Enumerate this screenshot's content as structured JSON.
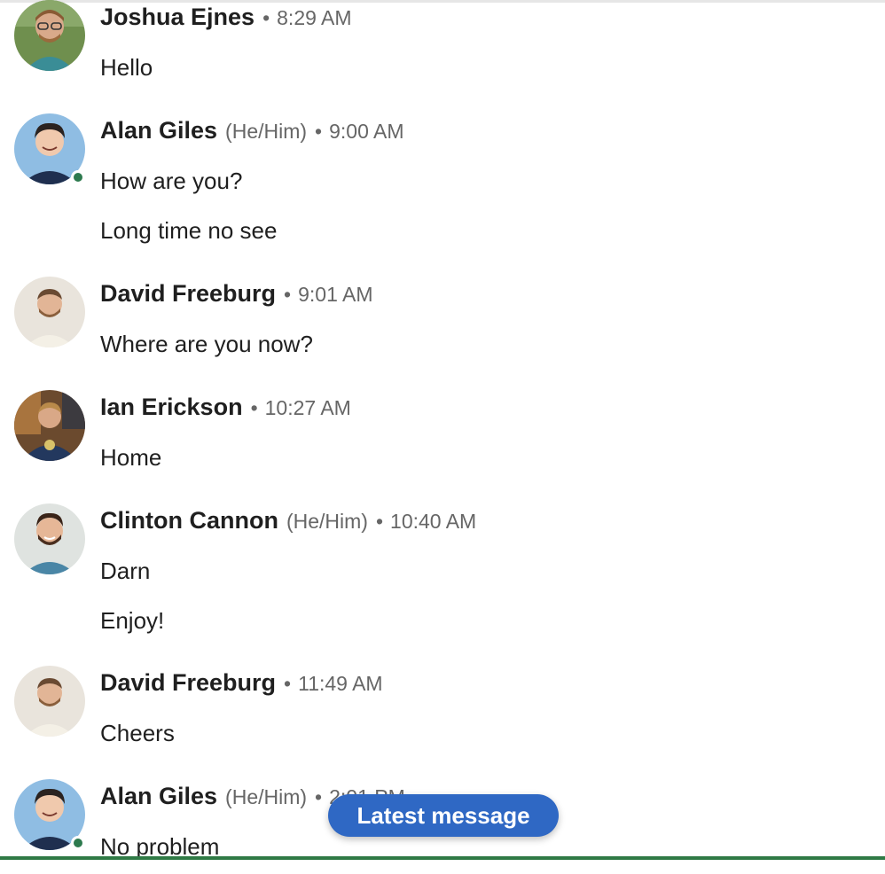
{
  "feed": {
    "messages": [
      {
        "name": "Joshua Ejnes",
        "pronoun": "",
        "time": "8:29 AM",
        "lines": [
          "Hello"
        ]
      },
      {
        "name": "Alan Giles",
        "pronoun": "(He/Him)",
        "time": "9:00 AM",
        "lines": [
          "How are you?",
          "Long time no see"
        ]
      },
      {
        "name": "David Freeburg",
        "pronoun": "",
        "time": "9:01 AM",
        "lines": [
          "Where are you now?"
        ]
      },
      {
        "name": "Ian Erickson",
        "pronoun": "",
        "time": "10:27 AM",
        "lines": [
          "Home"
        ]
      },
      {
        "name": "Clinton Cannon",
        "pronoun": "(He/Him)",
        "time": "10:40 AM",
        "lines": [
          "Darn",
          "Enjoy!"
        ]
      },
      {
        "name": "David Freeburg",
        "pronoun": "",
        "time": "11:49 AM",
        "lines": [
          "Cheers"
        ]
      },
      {
        "name": "Alan Giles",
        "pronoun": "(He/Him)",
        "time": "2:01 PM",
        "lines": [
          "No problem"
        ]
      }
    ]
  },
  "separator": "•",
  "latest_button": {
    "label": "Latest message"
  },
  "colors": {
    "accent": "#2f68c4",
    "presence": "#2d7a4e",
    "bottom_bar": "#2f7a45"
  }
}
